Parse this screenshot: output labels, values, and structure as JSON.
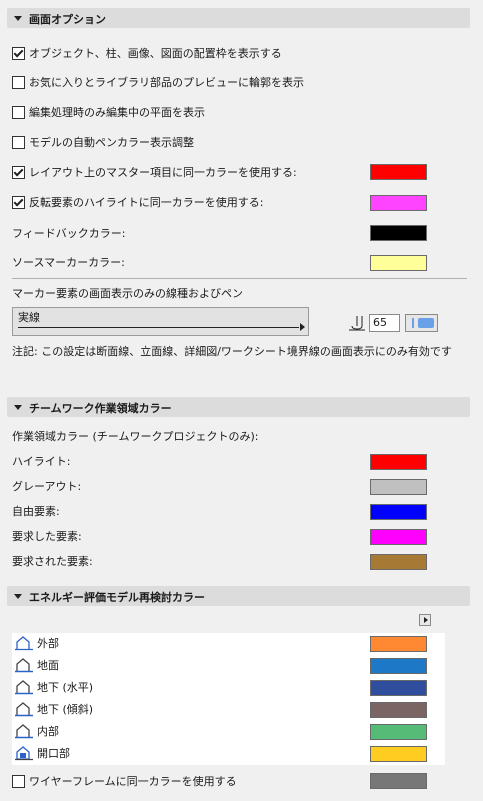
{
  "sections": {
    "display": "画面オプション",
    "teamwork": "チームワーク作業領域カラー",
    "energy": "エネルギー評価モデル再検討カラー"
  },
  "display": {
    "opt1": "オブジェクト、柱、画像、図面の配置枠を表示する",
    "opt2": "お気に入りとライブラリ部品のプレビューに輪郭を表示",
    "opt3": "編集処理時のみ編集中の平面を表示",
    "opt4": "モデルの自動ペンカラー表示調整",
    "opt5": "レイアウト上のマスター項目に同一カラーを使用する:",
    "opt6": "反転要素のハイライトに同一カラーを使用する:",
    "feedback": "フィードバックカラー:",
    "source": "ソースマーカーカラー:",
    "marker_heading": "マーカー要素の画面表示のみの線種およびペン",
    "line_type": "実線",
    "pen_number": "65",
    "note": "注記: この設定は断面線、立面線、詳細図/ワークシート境界線の画面表示にのみ有効です",
    "colors": {
      "master": "#ff0000",
      "highlight": "#ff44ff",
      "feedback": "#000000",
      "source": "#ffff99"
    },
    "checked": {
      "opt1": true,
      "opt2": false,
      "opt3": false,
      "opt4": false,
      "opt5": true,
      "opt6": true
    }
  },
  "teamwork": {
    "heading": "作業領域カラー (チームワークプロジェクトのみ):",
    "items": [
      {
        "label": "ハイライト:",
        "color": "#ff0000"
      },
      {
        "label": "グレーアウト:",
        "color": "#c0c0c0"
      },
      {
        "label": "自由要素:",
        "color": "#0000ff"
      },
      {
        "label": "要求した要素:",
        "color": "#ff00ff"
      },
      {
        "label": "要求された要素:",
        "color": "#a67a35"
      }
    ]
  },
  "energy": {
    "items": [
      {
        "label": "外部",
        "color": "#ff8833",
        "icon": "building-icon"
      },
      {
        "label": "地面",
        "color": "#1e78c8",
        "icon": "building-icon"
      },
      {
        "label": "地下 (水平)",
        "color": "#2f4f9e",
        "icon": "building-icon"
      },
      {
        "label": "地下 (傾斜)",
        "color": "#7a6464",
        "icon": "building-icon"
      },
      {
        "label": "内部",
        "color": "#55bb77",
        "icon": "building-icon"
      },
      {
        "label": "開口部",
        "color": "#ffcc22",
        "icon": "building-window-icon"
      }
    ],
    "wireframe": "ワイヤーフレームに同一カラーを使用する",
    "wireframe_color": "#777777",
    "wireframe_checked": false
  }
}
